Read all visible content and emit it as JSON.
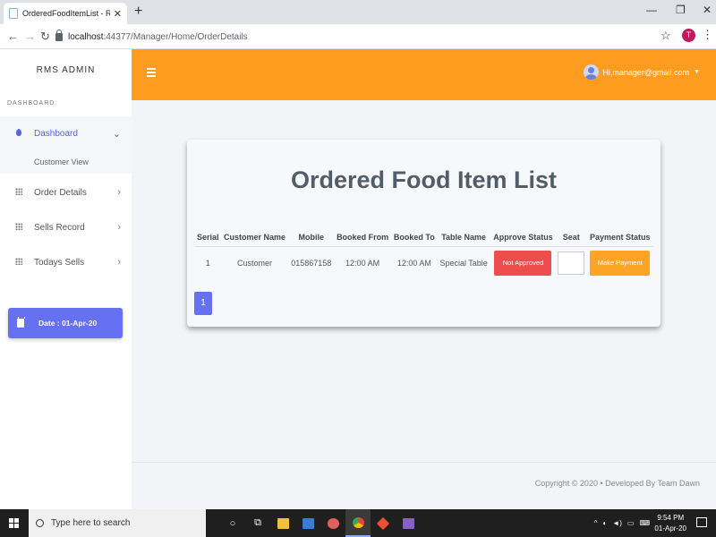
{
  "browser": {
    "tab_title": "OrderedFoodItemList - Resturant",
    "url_host": "localhost",
    "url_path": ":44377/Manager/Home/OrderDetails",
    "profile_initial": "T"
  },
  "sidebar": {
    "brand": "RMS ADMIN",
    "section_label": "DASHBOARD",
    "items": [
      {
        "label": "Dashboard"
      },
      {
        "label": "Order Details"
      },
      {
        "label": "Sells Record"
      },
      {
        "label": "Todays Sells"
      }
    ],
    "sub_item": "Customer View",
    "date_label": "Date : 01-Apr-20"
  },
  "topbar": {
    "user_label": "Hi,manager@gmail.com"
  },
  "main": {
    "title": "Ordered Food Item List",
    "table": {
      "headers": [
        "Serial",
        "Customer Name",
        "Mobile",
        "Booked From",
        "Booked To",
        "Table Name",
        "Approve Status",
        "Seat",
        "Payment Status"
      ],
      "rows": [
        {
          "serial": "1",
          "customer_name": "Customer",
          "mobile": "015867158",
          "booked_from": "12:00 AM",
          "booked_to": "12:00 AM",
          "table_name": "Special Table",
          "approve_status": "Not Approved",
          "seat": "",
          "payment_label": "Make Payment"
        }
      ]
    },
    "pagination": {
      "current": "1"
    }
  },
  "footer": {
    "text": "Copyright © 2020  •  Developed By Team Dawn"
  },
  "taskbar": {
    "search_placeholder": "Type here to search",
    "time": "9:54 PM",
    "date": "01-Apr-20"
  },
  "colors": {
    "accent_orange": "#fe9c1f",
    "accent_blue": "#6571f0",
    "danger_red": "#ee4d4d"
  }
}
